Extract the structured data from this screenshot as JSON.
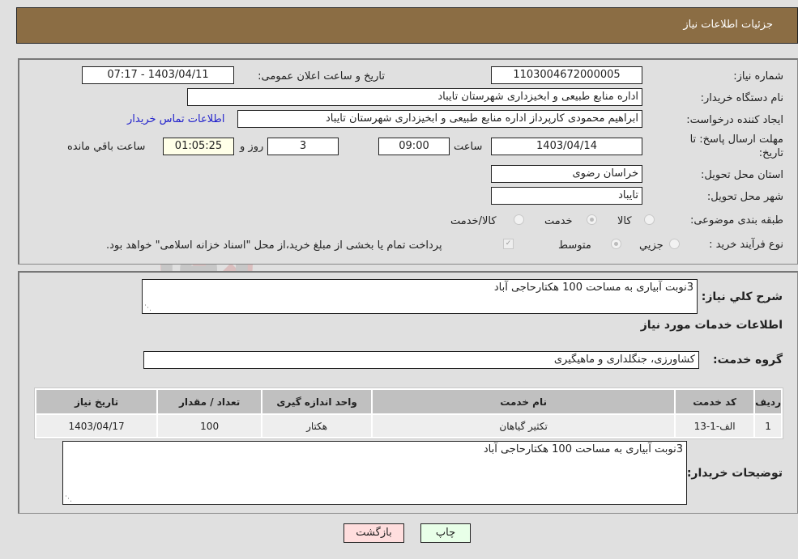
{
  "header": {
    "title": "جزئیات اطلاعات نیاز"
  },
  "fields": {
    "need_number": {
      "label": "شماره نیاز:",
      "value": "1103004672000005"
    },
    "announce_datetime": {
      "label": "تاریخ و ساعت اعلان عمومی:",
      "value": "1403/04/11 - 07:17"
    },
    "buyer_org": {
      "label": "نام دستگاه خریدار:",
      "value": "اداره منابع طبیعی و ابخیزداری شهرستان تایباد"
    },
    "requester": {
      "label": "ایجاد کننده درخواست:",
      "value": "ابراهیم محمودی کارپرداز اداره منابع طبیعی و ابخیزداری شهرستان تایباد"
    },
    "buyer_contact_link": "اطلاعات تماس خریدار",
    "deadline": {
      "label_line1": "مهلت ارسال پاسخ: تا",
      "label_line2": "تاریخ:",
      "date": "1403/04/14",
      "time_label": "ساعت",
      "time": "09:00",
      "days": "3",
      "days_label": "روز و",
      "remaining": "01:05:25",
      "remaining_label": "ساعت باقي مانده"
    },
    "delivery_province": {
      "label": "استان محل تحویل:",
      "value": "خراسان رضوی"
    },
    "delivery_city": {
      "label": "شهر محل تحویل:",
      "value": "تایباد"
    },
    "category": {
      "label": "طبقه بندی موضوعی:",
      "options": [
        "کالا",
        "خدمت",
        "کالا/خدمت"
      ],
      "selected": "خدمت"
    },
    "purchase_process": {
      "label": "نوع فرآیند خرید :",
      "options": [
        "جزیي",
        "متوسط"
      ],
      "selected": "متوسط",
      "treasury_note": "پرداخت تمام یا بخشی از مبلغ خرید،از محل \"اسناد خزانه اسلامی\" خواهد بود.",
      "treasury_checked": true
    }
  },
  "summary": {
    "label": "شرح کلي نیاز:",
    "value": "3نوبت آبیاری به مساحت 100 هکتارحاجی آباد"
  },
  "services_section": {
    "title": "اطلاعات خدمات مورد نیاز",
    "group_label": "گروه خدمت:",
    "group_value": "کشاورزی، جنگلداری و ماهیگیری",
    "table": {
      "headers": [
        "ردیف",
        "کد خدمت",
        "نام خدمت",
        "واحد اندازه گیری",
        "تعداد / مقدار",
        "تاریخ نیاز"
      ],
      "rows": [
        [
          "1",
          "الف-1-13",
          "تکثیر گیاهان",
          "هکتار",
          "100",
          "1403/04/17"
        ]
      ]
    }
  },
  "buyer_notes": {
    "label": "توضیحات خریدار:",
    "value": "3نوبت آبیاری به مساحت 100 هکتارحاجی آباد"
  },
  "buttons": {
    "print": "چاپ",
    "back": "بازگشت"
  },
  "watermark": {
    "text": "AriaTender.neT"
  }
}
